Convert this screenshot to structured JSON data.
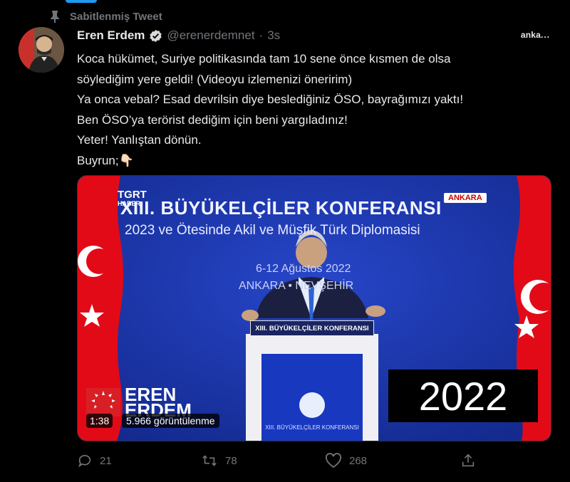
{
  "pinned": {
    "label": "Sabitlenmiş Tweet"
  },
  "author": {
    "name": "Eren Erdem",
    "handle": "@erenerdemnet",
    "separator": "·",
    "time": "3s"
  },
  "source_logo": {
    "text": "anka",
    "suffix": "..."
  },
  "tweet": {
    "lines": [
      "Koca hükümet, Suriye politikasında tam 10 sene önce kısmen de olsa",
      "söylediğim yere geldi! (Videoyu izlemenizi öneririm)",
      "Ya onca vebal? Esad devrilsin diye beslediğiniz ÖSO, bayrağımızı yaktı!",
      "Ben ÖSO’ya terörist dediğim için beni yargıladınız!",
      "Yeter! Yanlıştan dönün.",
      "Buyrun;👇🏻"
    ]
  },
  "video": {
    "channel_logo": {
      "line1": "TGRT",
      "line2": "HABER"
    },
    "location_badge": "ANKARA",
    "conference_title": "XIII. BÜYÜKELÇİLER KONFERANSI",
    "conference_subtitle": "2023 ve Ötesinde Akil ve Müşfik Türk Diplomasisi",
    "conference_dates": "6-12 Ağustos 2022",
    "conference_location": "ANKARA • NEVŞEHİR",
    "podium_label": "XIII. BÜYÜKELÇİLER KONFERANSI",
    "year_overlay": "2022",
    "watermark": {
      "line1": "EREN",
      "line2": "ERDEM"
    },
    "duration": "1:38",
    "views": "5.966 görüntülenme"
  },
  "actions": {
    "replies": "21",
    "retweets": "78",
    "likes": "268"
  },
  "colors": {
    "background": "#000000",
    "text": "#e7e9ea",
    "muted": "#71767b",
    "accent": "#1d9bf0",
    "video_bg": "#1c33a8",
    "flag_red": "#e30a17"
  }
}
